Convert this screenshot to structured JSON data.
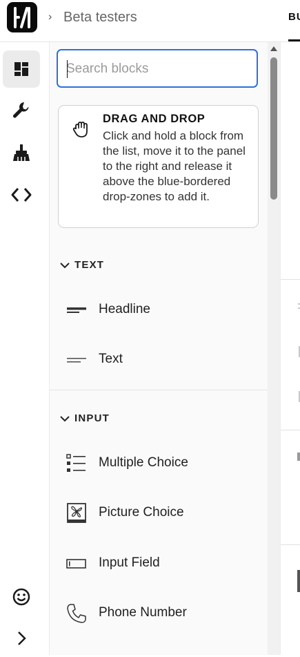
{
  "header": {
    "breadcrumb_chevron": "›",
    "breadcrumb": "Beta testers",
    "active_tab_partial": "BU"
  },
  "rail": {
    "items": [
      {
        "name": "blocks",
        "icon": "dashboard-icon",
        "active": true
      },
      {
        "name": "settings",
        "icon": "wrench-icon",
        "active": false
      },
      {
        "name": "theme",
        "icon": "broom-icon",
        "active": false
      },
      {
        "name": "code",
        "icon": "code-icon",
        "active": false
      }
    ],
    "bottom": [
      {
        "name": "feedback",
        "icon": "smiley-icon"
      },
      {
        "name": "expand",
        "icon": "chevron-right-icon"
      }
    ]
  },
  "search": {
    "placeholder": "Search blocks",
    "value": ""
  },
  "info_card": {
    "icon": "hand-grab-icon",
    "title": "DRAG AND DROP",
    "body": "Click and hold a block from the list, move it to the panel to the right and release it above the blue-bordered drop-zones to add it."
  },
  "sections": [
    {
      "title": "TEXT",
      "expanded": true,
      "items": [
        {
          "label": "Headline",
          "icon": "headline-icon"
        },
        {
          "label": "Text",
          "icon": "text-lines-icon"
        }
      ]
    },
    {
      "title": "INPUT",
      "expanded": true,
      "items": [
        {
          "label": "Multiple Choice",
          "icon": "list-choice-icon"
        },
        {
          "label": "Picture Choice",
          "icon": "picture-choice-icon"
        },
        {
          "label": "Input Field",
          "icon": "input-field-icon"
        },
        {
          "label": "Phone Number",
          "icon": "phone-icon"
        }
      ]
    }
  ],
  "colors": {
    "accent_focus": "#2f6fdb",
    "active_rail_bg": "#ebebeb",
    "panel_bg": "#fafafa"
  }
}
